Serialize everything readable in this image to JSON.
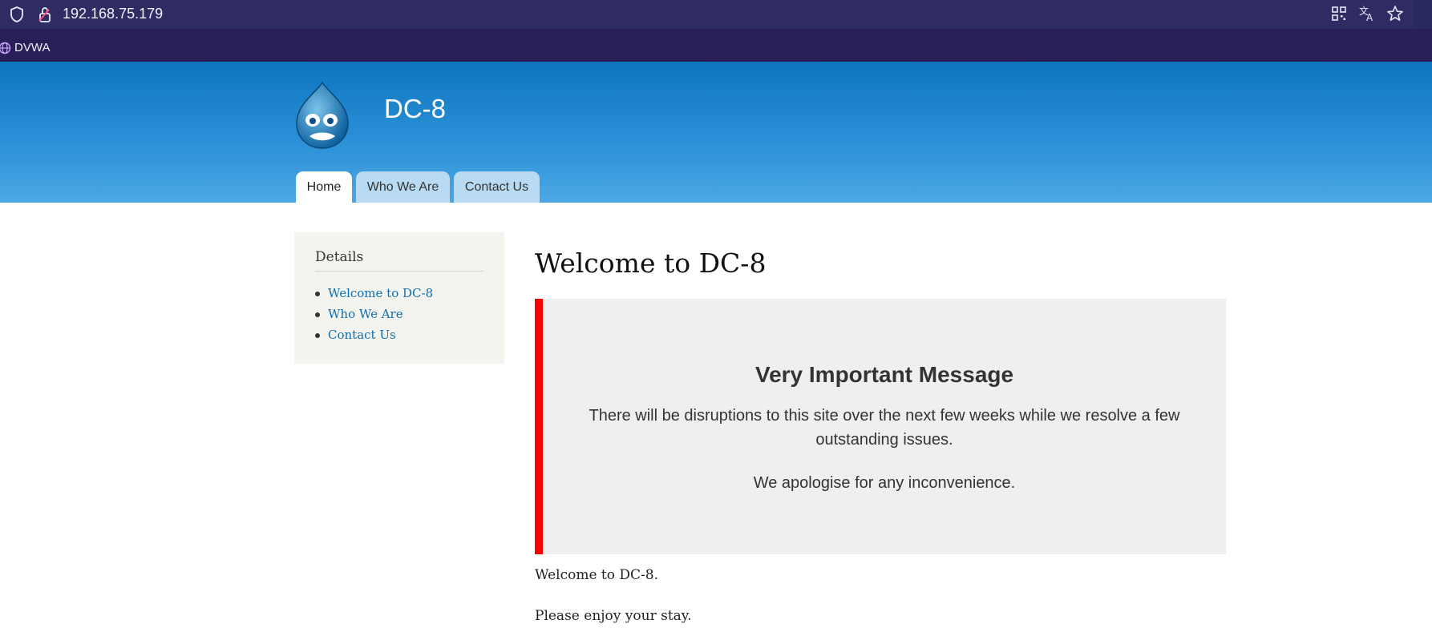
{
  "browser": {
    "url": "192.168.75.179",
    "bookmark_label": "DVWA",
    "icons": [
      "shield-icon",
      "lock-icon",
      "qr-code-icon",
      "translate-icon",
      "star-icon",
      "globe-icon"
    ]
  },
  "site": {
    "name": "DC-8",
    "logo": "drupal-drop-logo",
    "colors": {
      "header_top": "#0d76c0",
      "header_bottom": "#4ca8e5",
      "link": "#0e6fad",
      "alert_border": "#ff0000"
    },
    "tabs": [
      {
        "label": "Home",
        "active": true
      },
      {
        "label": "Who We Are",
        "active": false
      },
      {
        "label": "Contact Us",
        "active": false
      }
    ]
  },
  "sidebar": {
    "title": "Details",
    "links": [
      "Welcome to DC-8",
      "Who We Are",
      "Contact Us"
    ]
  },
  "main": {
    "title": "Welcome to DC-8",
    "message": {
      "title": "Very Important Message",
      "body": "There will be disruptions to this site over the next few weeks while we resolve a few outstanding issues.",
      "apology": "We apologise for any inconvenience."
    },
    "paragraphs": [
      "Welcome to DC-8.",
      "Please enjoy your stay."
    ]
  }
}
